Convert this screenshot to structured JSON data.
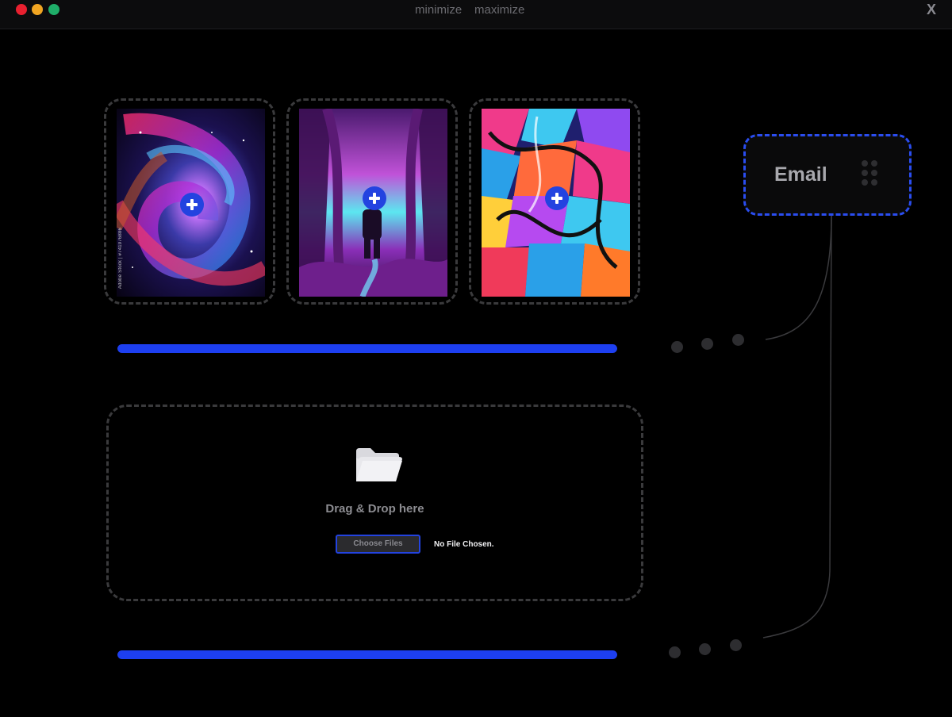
{
  "titlebar": {
    "minimize_label": "minimize",
    "maximize_label": "maximize",
    "close_label": "X",
    "traffic_colors": [
      "#e8202f",
      "#f0a522",
      "#1fae69"
    ]
  },
  "cards": [
    {
      "name": "galaxy-image",
      "watermark": "Adobe Stock | #741976886"
    },
    {
      "name": "forest-astronaut-image"
    },
    {
      "name": "graffiti-image"
    }
  ],
  "progress": [
    {
      "fraction": 1.0
    },
    {
      "fraction": 1.0
    }
  ],
  "email_node": {
    "label": "Email",
    "border_color": "#2a4df0"
  },
  "upload": {
    "drop_text": "Drag & Drop here",
    "button_label": "Choose Files",
    "status_text": "No File Chosen."
  },
  "colors": {
    "accent": "#1d3ff0",
    "background": "#000000",
    "dashed_border": "#3a3a3c"
  }
}
